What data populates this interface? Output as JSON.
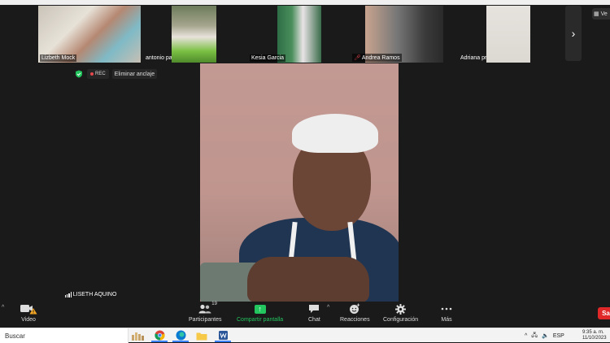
{
  "thumbnails": [
    {
      "name": "Lizbeth Mock",
      "muted": false
    },
    {
      "name": "antonio paz",
      "muted": false
    },
    {
      "name": "Kesia Garcia",
      "muted": false
    },
    {
      "name": "Andrea Ramos",
      "muted": true
    },
    {
      "name": "Adriana prado",
      "muted": false
    }
  ],
  "top_right": {
    "view_label": "Ve"
  },
  "status": {
    "rec_label": "REC",
    "unpin_label": "Eliminar anclaje"
  },
  "main_speaker": {
    "name": "LISETH AQUINO"
  },
  "toolbar": {
    "video_label": "Video",
    "participants_label": "Participantes",
    "participants_count": "19",
    "share_label": "Compartir pantalla",
    "chat_label": "Chat",
    "reactions_label": "Reacciones",
    "settings_label": "Configuración",
    "more_label": "Más",
    "leave_label": "Sa"
  },
  "taskbar": {
    "search_placeholder": "Buscar",
    "language": "ESP",
    "time": "9:35 a. m.",
    "date": "11/10/2023"
  },
  "colors": {
    "share_green": "#22c55e",
    "leave_red": "#e02828",
    "rec_red": "#e5484d"
  }
}
